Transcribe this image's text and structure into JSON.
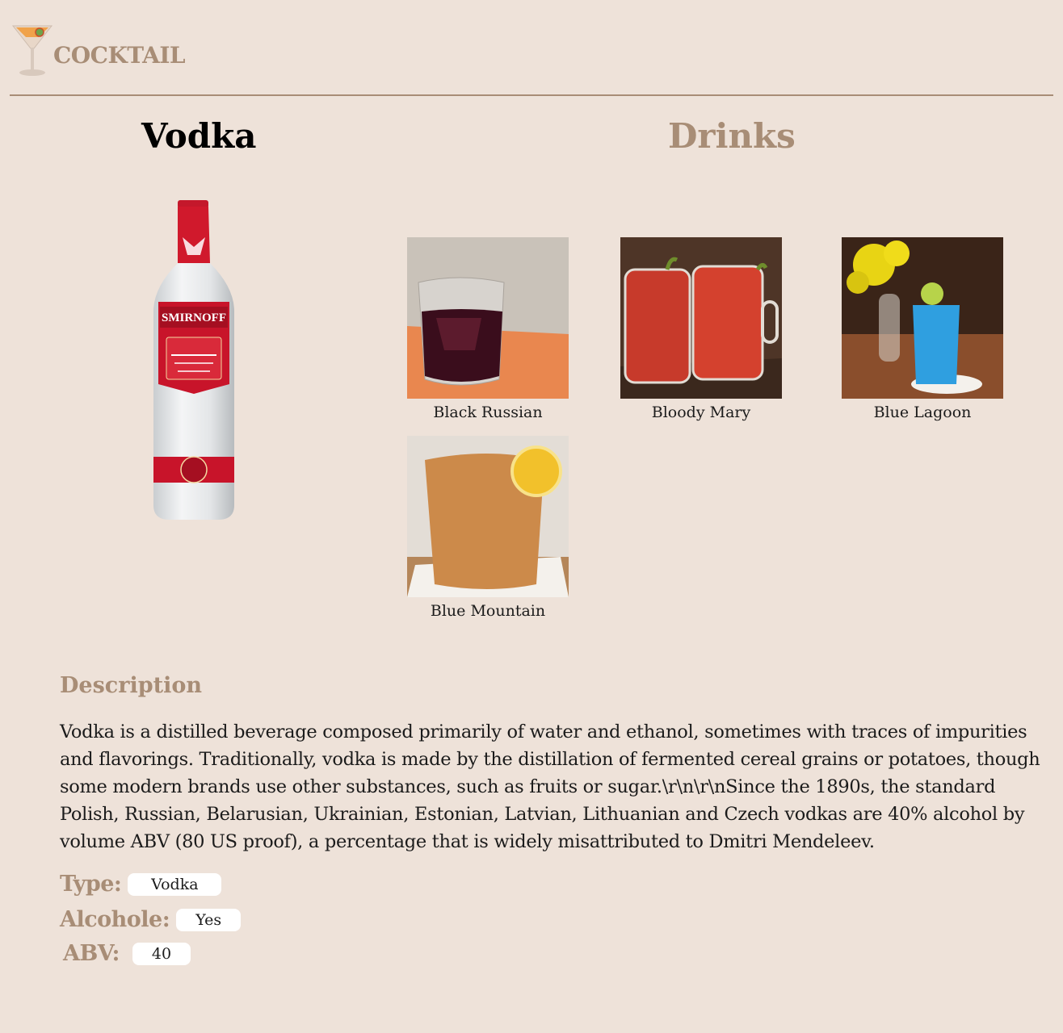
{
  "header": {
    "brand": "COCKTAIL",
    "logo_icon": "martini-glass-icon"
  },
  "ingredient": {
    "name": "Vodka",
    "image": "vodka-bottle-image"
  },
  "drinks": {
    "heading": "Drinks",
    "items": [
      {
        "name": "Black Russian",
        "image": "black-russian-photo"
      },
      {
        "name": "Bloody Mary",
        "image": "bloody-mary-photo"
      },
      {
        "name": "Blue Lagoon",
        "image": "blue-lagoon-photo"
      },
      {
        "name": "Blue Mountain",
        "image": "blue-mountain-photo"
      }
    ]
  },
  "description": {
    "heading": "Description",
    "text": "Vodka is a distilled beverage composed primarily of water and ethanol, sometimes with traces of impurities and flavorings. Traditionally, vodka is made by the distillation of fermented cereal grains or potatoes, though some modern brands use other substances, such as fruits or sugar.\\r\\n\\r\\nSince the 1890s, the standard Polish, Russian, Belarusian, Ukrainian, Estonian, Latvian, Lithuanian and Czech vodkas are 40% alcohol by volume ABV (80 US proof), a percentage that is widely misattributed to Dmitri Mendeleev."
  },
  "properties": {
    "type_label": "Type:",
    "type_value": "Vodka",
    "alcohol_label": "Alcohole:",
    "alcohol_value": "Yes",
    "abv_label": "ABV:",
    "abv_value": "40"
  },
  "colors": {
    "background": "#eee2d9",
    "accent": "#a88d76",
    "text": "#1b1b1b"
  }
}
